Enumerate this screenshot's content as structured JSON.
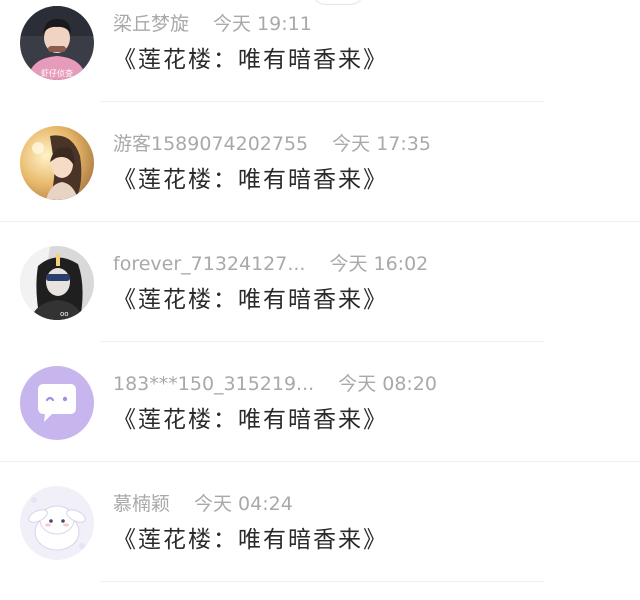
{
  "comments": [
    {
      "username": "梁丘梦旋",
      "time": "今天 19:11",
      "text": "《莲花楼：唯有暗香来》",
      "avatar_label": "虾仔侦查",
      "avatar": "boy-pink-hoodie"
    },
    {
      "username": "游客1589074202755",
      "time": "今天 17:35",
      "text": "《莲花楼：唯有暗香来》",
      "avatar": "anime-girl-golden"
    },
    {
      "username": "forever_71324127...",
      "time": "今天 16:02",
      "text": "《莲花楼：唯有暗香来》",
      "avatar": "girl-sunglasses-bw"
    },
    {
      "username": "183***150_315219...",
      "time": "今天 08:20",
      "text": "《莲花楼：唯有暗香来》",
      "avatar": "purple-chat-bubble-icon"
    },
    {
      "username": "慕楠颖",
      "time": "今天 04:24",
      "text": "《莲花楼：唯有暗香来》",
      "avatar": "cinnamoroll-cartoon"
    }
  ],
  "colors": {
    "meta_text": "#a9a9a9",
    "comment_text": "#2a2a2a",
    "purple_avatar": "#c7b6ee"
  }
}
